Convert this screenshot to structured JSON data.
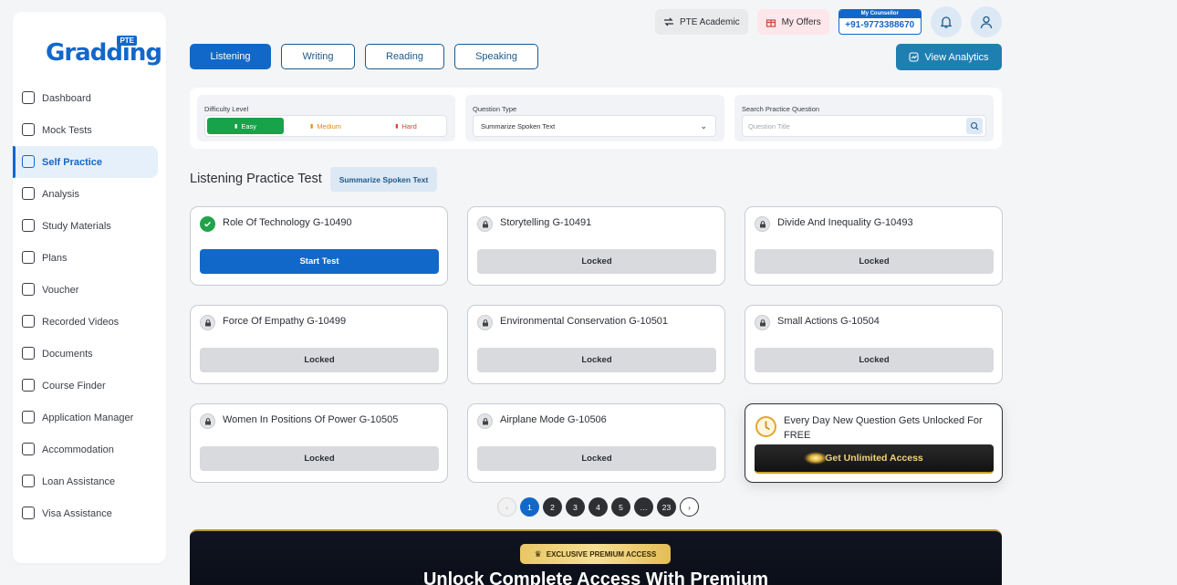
{
  "brand": {
    "name": "Gradding",
    "tag": "PTE"
  },
  "sidebar": {
    "items": [
      {
        "label": "Dashboard",
        "icon": "dashboard-icon"
      },
      {
        "label": "Mock Tests",
        "icon": "mock-tests-icon"
      },
      {
        "label": "Self Practice",
        "icon": "self-practice-icon"
      },
      {
        "label": "Analysis",
        "icon": "analysis-icon"
      },
      {
        "label": "Study Materials",
        "icon": "study-materials-icon"
      },
      {
        "label": "Plans",
        "icon": "plans-icon"
      },
      {
        "label": "Voucher",
        "icon": "voucher-icon"
      },
      {
        "label": "Recorded Videos",
        "icon": "recorded-videos-icon"
      },
      {
        "label": "Documents",
        "icon": "documents-icon"
      },
      {
        "label": "Course Finder",
        "icon": "course-finder-icon"
      },
      {
        "label": "Application Manager",
        "icon": "application-manager-icon"
      },
      {
        "label": "Accommodation",
        "icon": "accommodation-icon"
      },
      {
        "label": "Loan Assistance",
        "icon": "loan-assistance-icon"
      },
      {
        "label": "Visa Assistance",
        "icon": "visa-assistance-icon"
      }
    ],
    "active_index": 2
  },
  "header": {
    "exam_label": "PTE Academic",
    "offers_label": "My Offers",
    "counsellor_label": "My Counsellor",
    "counsellor_phone": "+91-9773388670"
  },
  "tabs": [
    {
      "label": "Listening",
      "active": true
    },
    {
      "label": "Writing",
      "active": false
    },
    {
      "label": "Reading",
      "active": false
    },
    {
      "label": "Speaking",
      "active": false
    }
  ],
  "analytics_label": "View Analytics",
  "filters": {
    "difficulty_label": "Difficulty Level",
    "difficulty_options": [
      "Easy",
      "Medium",
      "Hard"
    ],
    "difficulty_selected": "Easy",
    "question_type_label": "Question Type",
    "question_type_value": "Summarize Spoken Text",
    "search_label": "Search Practice Question",
    "search_placeholder": "Question Title"
  },
  "section": {
    "title": "Listening Practice Test",
    "badge": "Summarize Spoken Text"
  },
  "cards": [
    {
      "title": "Role Of Technology G-10490",
      "status": "unlocked",
      "button": "Start Test"
    },
    {
      "title": "Storytelling G-10491",
      "status": "locked",
      "button": "Locked"
    },
    {
      "title": "Divide And Inequality G-10493",
      "status": "locked",
      "button": "Locked"
    },
    {
      "title": "Force Of Empathy G-10499",
      "status": "locked",
      "button": "Locked"
    },
    {
      "title": "Environmental Conservation G-10501",
      "status": "locked",
      "button": "Locked"
    },
    {
      "title": "Small Actions G-10504",
      "status": "locked",
      "button": "Locked"
    },
    {
      "title": "Women In Positions Of Power G-10505",
      "status": "locked",
      "button": "Locked"
    },
    {
      "title": "Airplane Mode G-10506",
      "status": "locked",
      "button": "Locked"
    }
  ],
  "promo": {
    "text": "Every Day New Question Gets Unlocked For FREE",
    "button": "Get Unlimited Access"
  },
  "pagination": {
    "prev": "‹",
    "pages": [
      "1",
      "2",
      "3",
      "4",
      "5",
      "…",
      "23"
    ],
    "current": "1",
    "next": "›"
  },
  "premium": {
    "pill": "EXCLUSIVE PREMIUM ACCESS",
    "title": "Unlock Complete Access With Premium"
  },
  "colors": {
    "primary": "#1268c9",
    "easy": "#17a34a",
    "medium": "#d98c1a",
    "hard": "#d0433c",
    "gold": "#e9c765"
  }
}
